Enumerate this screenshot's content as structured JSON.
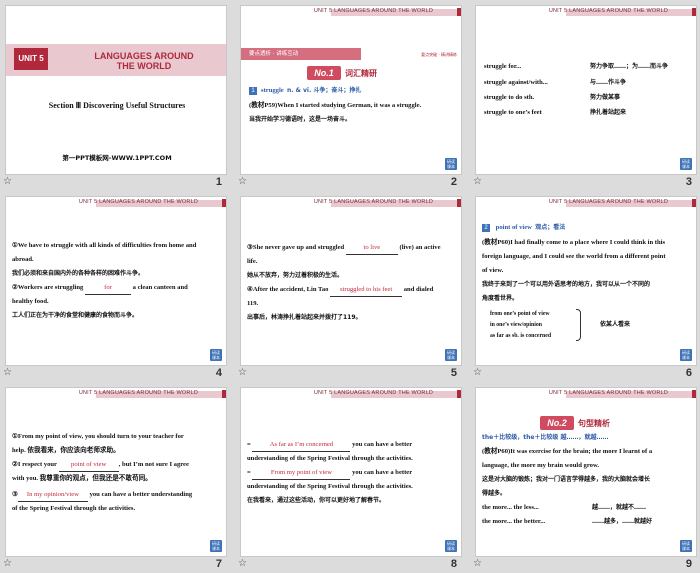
{
  "header_text": "UNIT 5   LANGUAGES AROUND THE WORLD",
  "corner_button": "研读\n课本",
  "slides": [
    {
      "number": "1",
      "unit_label": "UNIT 5",
      "title_line1": "LANGUAGES AROUND",
      "title_line2": "THE WORLD",
      "section": "Section Ⅲ   Discovering Useful Structures",
      "site": "第一PPT模板网-WWW.1PPT.COM"
    },
    {
      "number": "2",
      "banner": "要点透析 · 讲练互动",
      "banner_right": "要点突破 · 精讲精练",
      "badge": "No.1",
      "badge_title": "词汇精研",
      "word_idx": "1",
      "word": "struggle",
      "word_pos": "n. & vi. 斗争；奋斗；挣扎",
      "line1": "(教材P59)When I started studying German, it was a struggle.",
      "line2": "当我开始学习德语时，这是一场奋斗。"
    },
    {
      "number": "3",
      "rows": [
        {
          "en": "struggle for...",
          "cn": "努力争取……；为……而斗争"
        },
        {
          "en": "struggle against/with...",
          "cn": "与……作斗争"
        },
        {
          "en": "struggle to do sth.",
          "cn": "努力做某事"
        },
        {
          "en": "struggle to one’s feet",
          "cn": "挣扎着站起来"
        }
      ]
    },
    {
      "number": "4",
      "l1": "①We have to struggle with all kinds of difficulties from home and",
      "l2": "abroad.",
      "l3": "我们必须和来自国内外的各种各样的困难作斗争。",
      "l4a": "②Workers are struggling",
      "l4b": "for",
      "l4c": "a clean canteen and",
      "l5": "healthy food.",
      "l6": "工人们正在为干净的食堂和健康的食物而斗争。"
    },
    {
      "number": "5",
      "l1a": "③She never gave up and struggled",
      "l1b": "to live",
      "l1c": "(live) an active",
      "l2": "life.",
      "l3": "她从不放弃，努力过着积极的生活。",
      "l4a": "④After the accident, Lin Tao",
      "l4b": "struggled to his feet",
      "l4c": "and dialed",
      "l5": "119.",
      "l6": "出事后，林涛挣扎着站起来并拨打了119。"
    },
    {
      "number": "6",
      "idx": "2",
      "word": "point of view",
      "word_cn": "观点；看法",
      "l1": "(教材P60)I had finally come to a place where I could think in this",
      "l2": "foreign language, and I could see the world from a different point",
      "l3": "of view.",
      "l4": "我终于来到了一个可以用外语思考的地方，我可以从一个不同的",
      "l5": "角度看世界。",
      "phr1": "from one’s point of view",
      "phr2": "in one’s view/opinion",
      "phr3": "as far as sb.    is concerned",
      "phr_cn": "依某人看来"
    },
    {
      "number": "7",
      "l1": "①From my point of view, you should turn to your teacher for",
      "l2": "help.    依我看来，你应该向老师求助。",
      "l3a": "②I respect your",
      "l3b": "point of view",
      "l3c": ", but I’m not sure I agree",
      "l4": "with you.    我尊重你的观点，但我还是不敢苟同。",
      "l5a": "③",
      "l5b": "In my opinion/view",
      "l5c": "you can have a better understanding",
      "l6": "of the Spring Festival through the activities."
    },
    {
      "number": "8",
      "l1a": "=",
      "l1b": "As far as I’m concerned",
      "l1c": "you can have a better",
      "l2": "understanding of the Spring Festival through the activities.",
      "l3a": "=",
      "l3b": "From my point of view",
      "l3c": "you can have a better",
      "l4": "understanding of the Spring Festival through the activities.",
      "l5": "在我看来，通过这些活动，你可以更好地了解春节。"
    },
    {
      "number": "9",
      "badge": "No.2",
      "badge_title": "句型精析",
      "head": "the＋比较级，the＋比较级   越……，就越……",
      "l1": "(教材P60)It was exercise for the brain; the more I learnt of a",
      "l2": "language, the more my brain would grow.",
      "l3": "这是对大脑的锻炼；我对一门语言学得越多，我的大脑就会增长",
      "l4": "得越多。",
      "r1a": "the more... the less...",
      "r1b": "越……，就越不……",
      "r2a": "the more... the better...",
      "r2b": "……越多，……就越好"
    }
  ]
}
